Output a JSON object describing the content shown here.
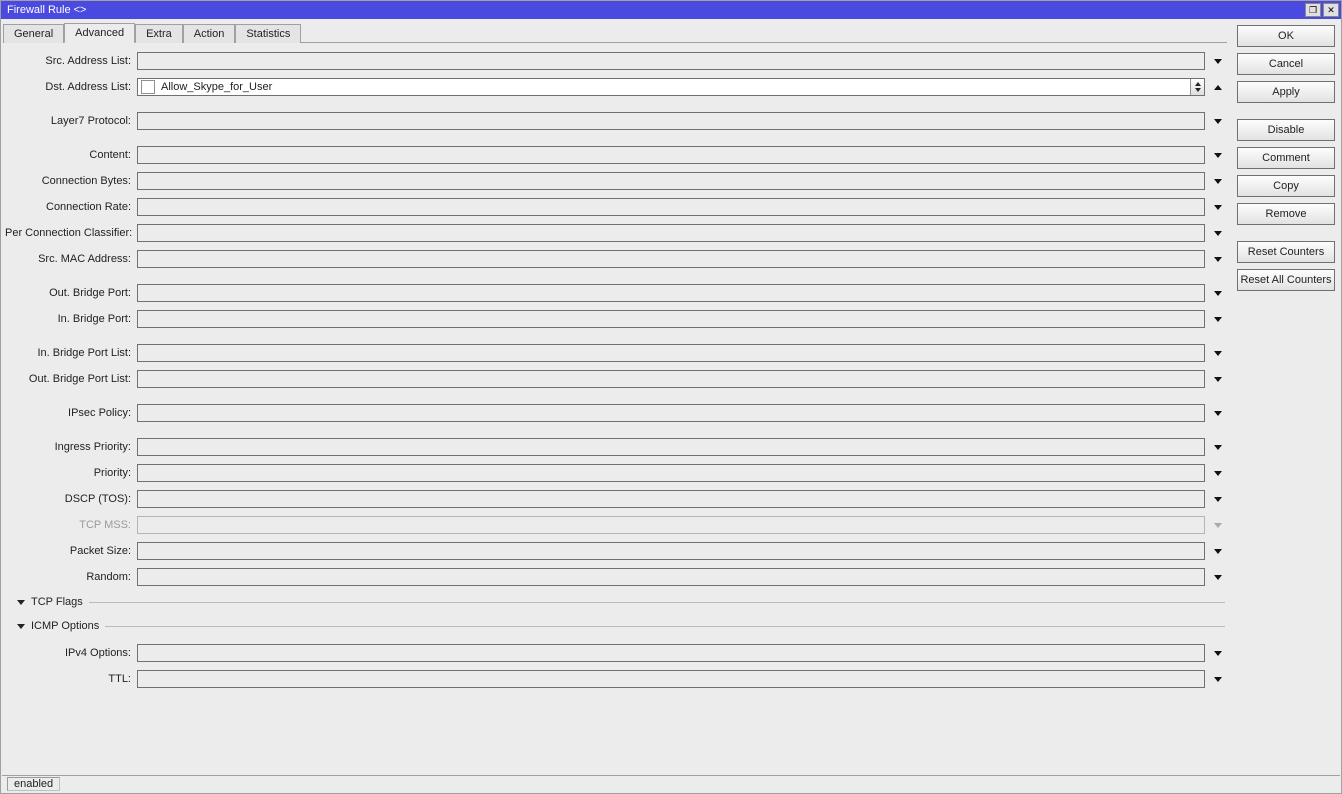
{
  "window": {
    "title": "Firewall Rule <>"
  },
  "tabs": {
    "general": "General",
    "advanced": "Advanced",
    "extra": "Extra",
    "action": "Action",
    "statistics": "Statistics",
    "active": "advanced"
  },
  "fields": {
    "src_address_list": {
      "label": "Src. Address List:",
      "value": ""
    },
    "dst_address_list": {
      "label": "Dst. Address List:",
      "value": "Allow_Skype_for_User"
    },
    "layer7_protocol": {
      "label": "Layer7 Protocol:",
      "value": ""
    },
    "content": {
      "label": "Content:",
      "value": ""
    },
    "connection_bytes": {
      "label": "Connection Bytes:",
      "value": ""
    },
    "connection_rate": {
      "label": "Connection Rate:",
      "value": ""
    },
    "per_connection_classifier": {
      "label": "Per Connection Classifier:",
      "value": ""
    },
    "src_mac_address": {
      "label": "Src. MAC Address:",
      "value": ""
    },
    "out_bridge_port": {
      "label": "Out. Bridge Port:",
      "value": ""
    },
    "in_bridge_port": {
      "label": "In. Bridge Port:",
      "value": ""
    },
    "in_bridge_port_list": {
      "label": "In. Bridge Port List:",
      "value": ""
    },
    "out_bridge_port_list": {
      "label": "Out. Bridge Port List:",
      "value": ""
    },
    "ipsec_policy": {
      "label": "IPsec Policy:",
      "value": ""
    },
    "ingress_priority": {
      "label": "Ingress Priority:",
      "value": ""
    },
    "priority": {
      "label": "Priority:",
      "value": ""
    },
    "dscp_tos": {
      "label": "DSCP (TOS):",
      "value": ""
    },
    "tcp_mss": {
      "label": "TCP MSS:",
      "value": ""
    },
    "packet_size": {
      "label": "Packet Size:",
      "value": ""
    },
    "random": {
      "label": "Random:",
      "value": ""
    },
    "ipv4_options": {
      "label": "IPv4 Options:",
      "value": ""
    },
    "ttl": {
      "label": "TTL:",
      "value": ""
    }
  },
  "sections": {
    "tcp_flags": "TCP Flags",
    "icmp_options": "ICMP Options"
  },
  "buttons": {
    "ok": "OK",
    "cancel": "Cancel",
    "apply": "Apply",
    "disable": "Disable",
    "comment": "Comment",
    "copy": "Copy",
    "remove": "Remove",
    "reset_counters": "Reset Counters",
    "reset_all_counters": "Reset All Counters"
  },
  "status": {
    "text": "enabled"
  }
}
